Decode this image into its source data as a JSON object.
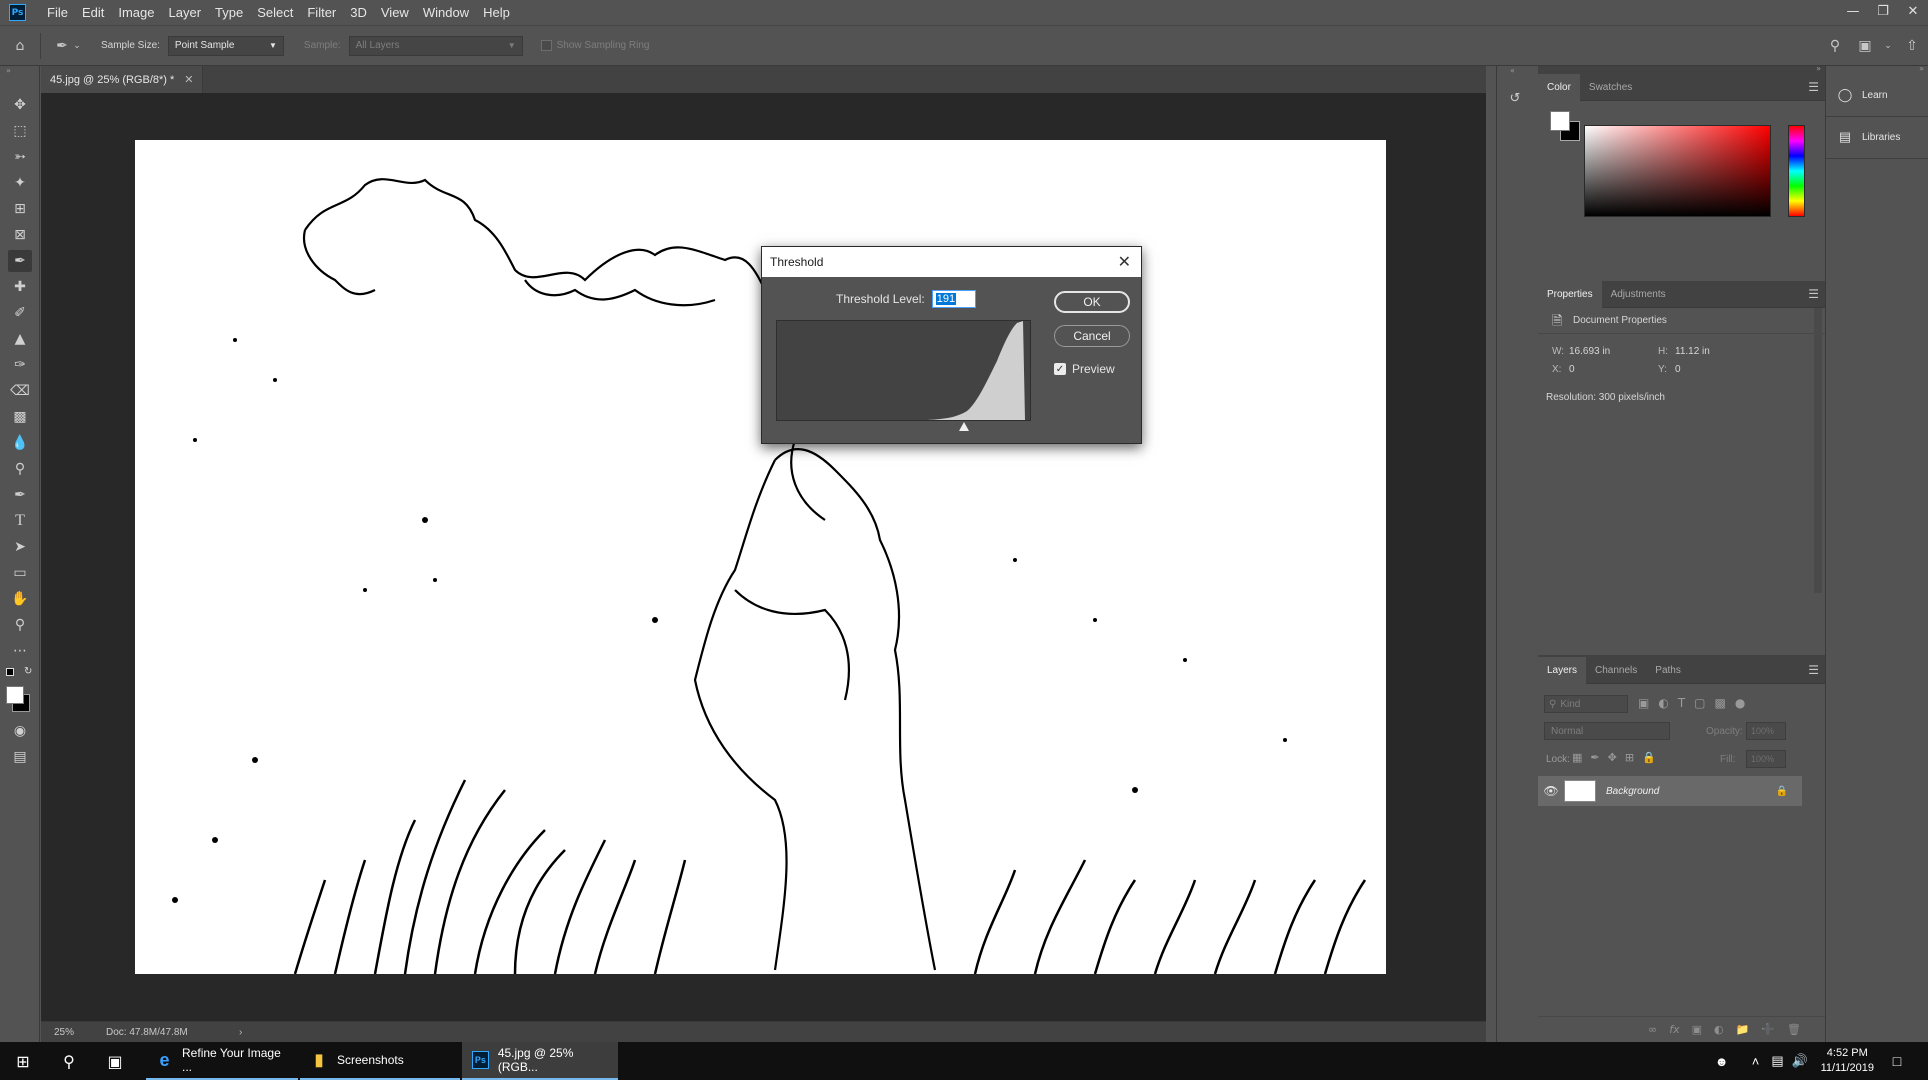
{
  "menubar": {
    "logo": "Ps",
    "items": [
      "File",
      "Edit",
      "Image",
      "Layer",
      "Type",
      "Select",
      "Filter",
      "3D",
      "View",
      "Window",
      "Help"
    ]
  },
  "options": {
    "sample_size_label": "Sample Size:",
    "sample_size_value": "Point Sample",
    "sample_label": "Sample:",
    "sample_value": "All Layers",
    "show_sampling_ring": "Show Sampling Ring"
  },
  "document": {
    "tab_title": "45.jpg @ 25% (RGB/8*) *",
    "zoom": "25%",
    "doc_size": "Doc: 47.8M/47.8M"
  },
  "threshold": {
    "title": "Threshold",
    "level_label": "Threshold Level:",
    "level_value": "191",
    "ok": "OK",
    "cancel": "Cancel",
    "preview": "Preview",
    "preview_checked": true
  },
  "color_panel": {
    "tabs": [
      "Color",
      "Swatches"
    ]
  },
  "properties_panel": {
    "tabs": [
      "Properties",
      "Adjustments"
    ],
    "title": "Document Properties",
    "w_label": "W:",
    "w_value": "16.693 in",
    "h_label": "H:",
    "h_value": "11.12 in",
    "x_label": "X:",
    "x_value": "0",
    "y_label": "Y:",
    "y_value": "0",
    "resolution": "Resolution: 300 pixels/inch"
  },
  "layers_panel": {
    "tabs": [
      "Layers",
      "Channels",
      "Paths"
    ],
    "kind_placeholder": "Kind",
    "blend_mode": "Normal",
    "opacity_label": "Opacity:",
    "opacity_value": "100%",
    "lock_label": "Lock:",
    "fill_label": "Fill:",
    "fill_value": "100%",
    "layer_name": "Background"
  },
  "learn_col": {
    "learn": "Learn",
    "libraries": "Libraries"
  },
  "taskbar": {
    "apps": [
      {
        "label": "Refine Your Image ...",
        "icon": "edge-icon"
      },
      {
        "label": "Screenshots",
        "icon": "folder-icon"
      },
      {
        "label": "45.jpg @ 25% (RGB...",
        "icon": "photoshop-icon"
      }
    ],
    "time": "4:52 PM",
    "date": "11/11/2019"
  },
  "colors": {
    "accent": "#31a8ff",
    "selection": "#0078d7"
  }
}
